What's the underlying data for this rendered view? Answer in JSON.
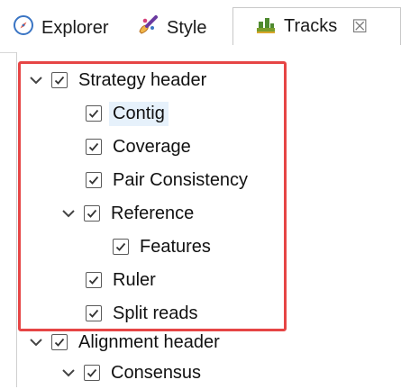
{
  "tabs": [
    {
      "label": "Explorer",
      "icon": "compass-icon"
    },
    {
      "label": "Style",
      "icon": "paint-brush-icon"
    },
    {
      "label": "Tracks",
      "icon": "tracks-icon",
      "close": "☒"
    }
  ],
  "tree": [
    {
      "label": "Strategy header",
      "expanded": true,
      "checked": true
    },
    {
      "label": "Contig",
      "checked": true,
      "selected": true
    },
    {
      "label": "Coverage",
      "checked": true
    },
    {
      "label": "Pair Consistency",
      "checked": true
    },
    {
      "label": "Reference",
      "expanded": true,
      "checked": true
    },
    {
      "label": "Features",
      "checked": true
    },
    {
      "label": "Ruler",
      "checked": true
    },
    {
      "label": "Split reads",
      "checked": true
    },
    {
      "label": "Alignment header",
      "expanded": true,
      "checked": true
    },
    {
      "label": "Consensus",
      "expanded": true,
      "checked": true
    }
  ],
  "colors": {
    "highlight_border": "#e64545",
    "selection_bg": "#e6f1fb"
  }
}
